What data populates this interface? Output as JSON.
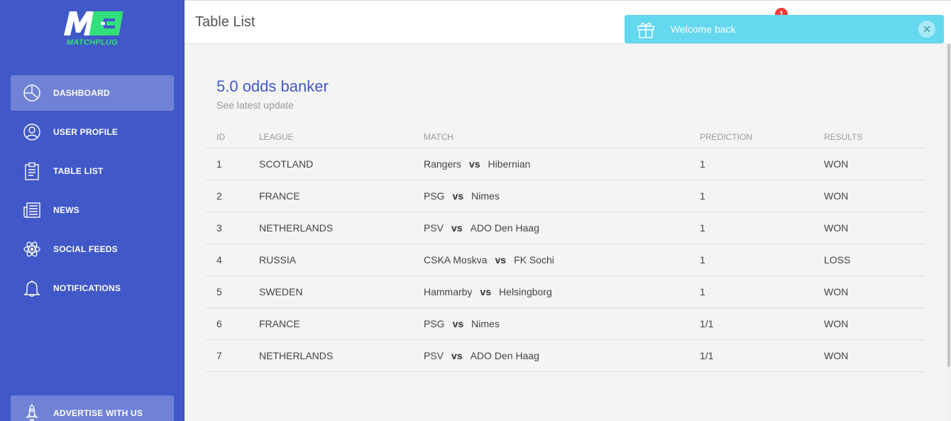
{
  "brand": {
    "logo_text": "MATCHPLUG"
  },
  "sidebar": {
    "items": [
      {
        "label": "DASHBOARD",
        "icon": "pie-chart-icon",
        "active": true
      },
      {
        "label": "USER PROFILE",
        "icon": "user-circle-icon",
        "active": false
      },
      {
        "label": "TABLE LIST",
        "icon": "clipboard-icon",
        "active": false
      },
      {
        "label": "NEWS",
        "icon": "newspaper-icon",
        "active": false
      },
      {
        "label": "SOCIAL FEEDS",
        "icon": "atom-icon",
        "active": false
      },
      {
        "label": "NOTIFICATIONS",
        "icon": "bell-icon",
        "active": false
      }
    ],
    "advertise": {
      "label": "ADVERTISE WITH US",
      "icon": "rocket-icon"
    }
  },
  "header": {
    "title": "Table List",
    "notification_count": "1"
  },
  "toast": {
    "message": "Welcome back",
    "icon": "gift-icon",
    "close_icon": "close-icon"
  },
  "card": {
    "title": "5.0 odds banker",
    "subtitle": "See latest update",
    "columns": [
      "ID",
      "LEAGUE",
      "MATCH",
      "PREDICTION",
      "RESULTS"
    ],
    "vs_label": "vs",
    "rows": [
      {
        "id": "1",
        "league": "SCOTLAND",
        "home": "Rangers",
        "away": "Hibernian",
        "prediction": "1",
        "result": "WON"
      },
      {
        "id": "2",
        "league": "FRANCE",
        "home": "PSG",
        "away": "Nimes",
        "prediction": "1",
        "result": "WON"
      },
      {
        "id": "3",
        "league": "NETHERLANDS",
        "home": "PSV",
        "away": "ADO Den Haag",
        "prediction": "1",
        "result": "WON"
      },
      {
        "id": "4",
        "league": "RUSSIA",
        "home": "CSKA Moskva",
        "away": "FK Sochi",
        "prediction": "1",
        "result": "LOSS"
      },
      {
        "id": "5",
        "league": "SWEDEN",
        "home": "Hammarby",
        "away": "Helsingborg",
        "prediction": "1",
        "result": "WON"
      },
      {
        "id": "6",
        "league": "FRANCE",
        "home": "PSG",
        "away": "Nimes",
        "prediction": "1/1",
        "result": "WON"
      },
      {
        "id": "7",
        "league": "NETHERLANDS",
        "home": "PSV",
        "away": "ADO Den Haag",
        "prediction": "1/1",
        "result": "WON"
      }
    ]
  },
  "colors": {
    "sidebar": "#4158c8",
    "accent_green": "#31e07a",
    "toast": "#63d8ef",
    "badge": "#f03b3b"
  }
}
